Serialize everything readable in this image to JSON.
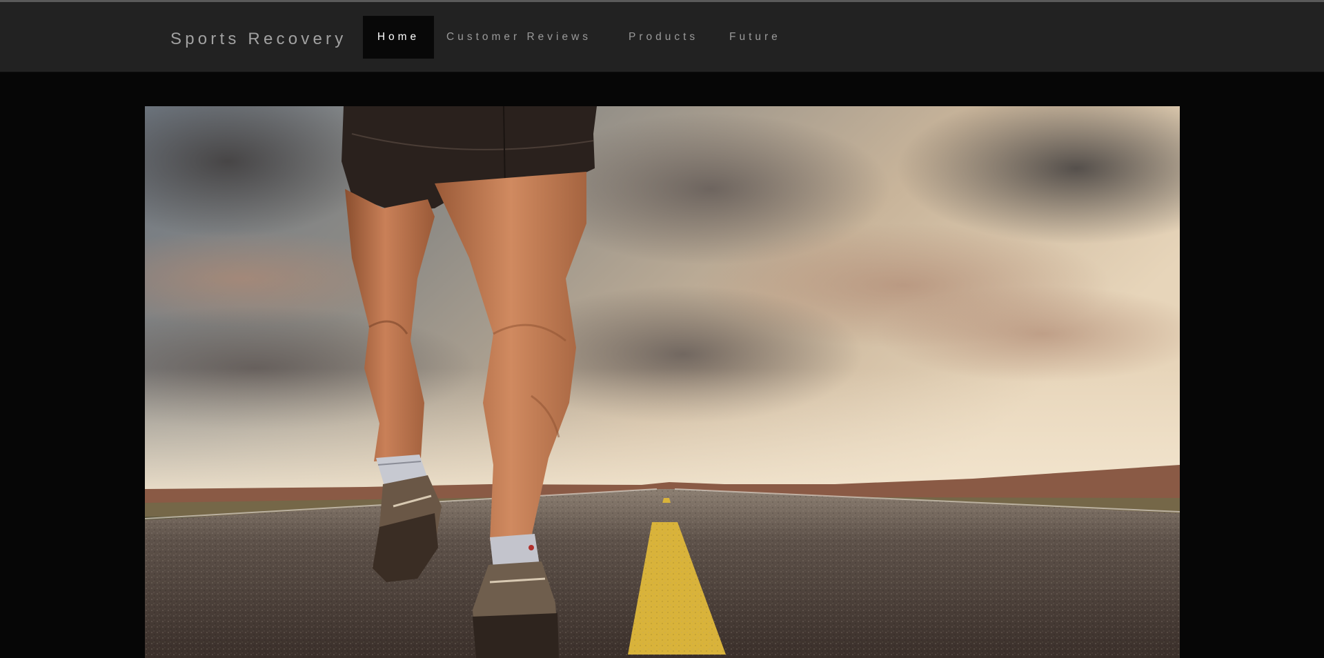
{
  "navbar": {
    "brand": "Sports Recovery",
    "items": [
      {
        "label": "Home",
        "active": true
      },
      {
        "label": "Customer Reviews",
        "active": false
      },
      {
        "label": "Products",
        "active": false
      },
      {
        "label": "Future",
        "active": false
      }
    ]
  },
  "hero": {
    "image": "runner-legs-on-desert-road-photo"
  },
  "colors": {
    "navbar_bg": "#222222",
    "page_bg": "#060606",
    "active_tab_bg": "#080808",
    "road_line": "#d9b33a"
  }
}
